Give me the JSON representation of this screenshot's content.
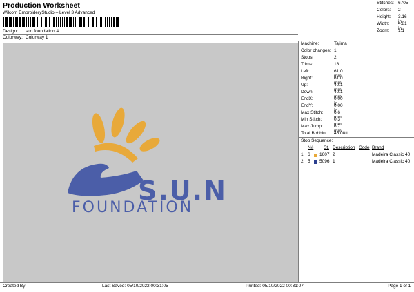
{
  "header": {
    "title": "Production Worksheet",
    "subtitle": "Wilcom EmbroideryStudio – Level 3 Advanced",
    "design_label": "Design:",
    "design_value": "sun foundation 4",
    "colorway_label": "Colorway:",
    "colorway_value": "Colorway 1"
  },
  "summary": [
    {
      "label": "Stitches:",
      "value": "6705"
    },
    {
      "label": "Colors:",
      "value": "2"
    },
    {
      "label": "Height:",
      "value": "3.16 in"
    },
    {
      "label": "Width:",
      "value": "4.81 in"
    },
    {
      "label": "Zoom:",
      "value": "1:1"
    }
  ],
  "details": [
    {
      "label": "Machine:",
      "value": "Tajima"
    },
    {
      "label": "Color changes:",
      "value": "1"
    },
    {
      "label": "Stops:",
      "value": "2"
    },
    {
      "label": "Trims:",
      "value": "18"
    },
    {
      "label": "Left:",
      "value": "61.0 mm"
    },
    {
      "label": "Right:",
      "value": "61.0 mm"
    },
    {
      "label": "Up:",
      "value": "40.1 mm"
    },
    {
      "label": "Down:",
      "value": "40.1 mm"
    },
    {
      "label": "EndX:",
      "value": "0.00 in"
    },
    {
      "label": "EndY:",
      "value": "0.00 in"
    },
    {
      "label": "Max Stitch:",
      "value": "6.6 mm"
    },
    {
      "label": "Min Stitch:",
      "value": "0.3 mm"
    },
    {
      "label": "Max Jump:",
      "value": "6.7 mm"
    },
    {
      "label": "Total Bobbin:",
      "value": "45.08ft"
    }
  ],
  "stop_sequence": {
    "title": "Stop Sequence:",
    "columns": [
      "N#",
      "St.",
      "Description",
      "Code",
      "Brand"
    ],
    "rows": [
      {
        "index": "1.",
        "n": "6",
        "color": "#e8a93a",
        "st": "1607",
        "description": "2",
        "code": "",
        "brand": "Madeira Classic 40"
      },
      {
        "index": "2.",
        "n": "5",
        "color": "#2b3f8f",
        "st": "5096",
        "description": "1",
        "code": "",
        "brand": "Madeira Classic 40"
      }
    ]
  },
  "design": {
    "logo_word": "S.U.N",
    "logo_sub": "FOUNDATION",
    "colors": {
      "gold": "#e8a93a",
      "blue": "#4b5ea8",
      "bg": "#c8c8c8"
    }
  },
  "footer": {
    "created_by": "Created By:",
    "last_saved": "Last Saved: 05/10/2022 00:31:05",
    "printed": "Printed: 05/10/2022 00:31:07",
    "page": "Page 1 of 1"
  }
}
